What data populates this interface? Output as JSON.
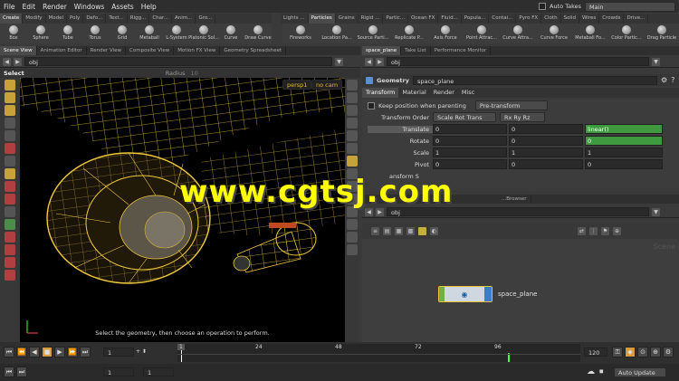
{
  "menubar": {
    "items": [
      "File",
      "Edit",
      "Render",
      "Windows",
      "Assets",
      "Help"
    ],
    "auto_takes": "Auto Takes",
    "desktop": "Main"
  },
  "shelf_left": {
    "tabs": [
      "Create",
      "Modify",
      "Model",
      "Poly",
      "Defo...",
      "Text...",
      "Rigg...",
      "Char...",
      "Anim...",
      "Gro..."
    ],
    "tools": [
      "Box",
      "Sphere",
      "Tube",
      "Torus",
      "Grid",
      "Metaball",
      "L-System",
      "Platonic Sol...",
      "Curve",
      "Draw Curve"
    ]
  },
  "shelf_right": {
    "tabs": [
      "Lights ...",
      "Particles",
      "Grains",
      "Rigid ...",
      "Partic...",
      "Ocean FX",
      "Fluid...",
      "Popula...",
      "Contai...",
      "Pyro FX",
      "Cloth",
      "Solid",
      "Wires",
      "Crowds",
      "Drive..."
    ],
    "tools": [
      "Fireworks",
      "Location Pa...",
      "Source Parti...",
      "Replicate P...",
      "Axis Force",
      "Point Attrac...",
      "Curve Attra...",
      "Curve Force",
      "Metaball Fo...",
      "Color Partic...",
      "Drag Particle"
    ]
  },
  "left_pane": {
    "tabs": [
      "Scene View",
      "Animation Editor",
      "Render View",
      "Composite View",
      "Motion FX View",
      "Geometry Spreadsheet"
    ],
    "path": "obj",
    "select_label": "Select",
    "radius_label": "Radius",
    "radius_value": "10",
    "persp": "persp1",
    "cam": "no cam",
    "prompt": "Select the geometry, then choose an operation to perform."
  },
  "params_pane": {
    "tabs": [
      "space_plane",
      "Take List",
      "Performance Monitor"
    ],
    "path": "obj",
    "node_type": "Geometry",
    "node_name": "space_plane",
    "sub_tabs": [
      "Transform",
      "Material",
      "Render",
      "Misc"
    ],
    "keep_position_label": "Keep position when parenting",
    "keep_position_value": "Pre-transform",
    "transform_order_label": "Transform Order",
    "transform_order_value": "Scale Rot Trans",
    "rot_order_value": "Rx Ry Rz",
    "rows": [
      {
        "label": "Translate",
        "values": [
          "0",
          "0",
          "linear()"
        ]
      },
      {
        "label": "Rotate",
        "values": [
          "0",
          "0",
          "0"
        ]
      },
      {
        "label": "Scale",
        "values": [
          "1",
          "1",
          "1"
        ]
      },
      {
        "label": "Pivot",
        "values": [
          "0",
          "0",
          "0"
        ]
      }
    ],
    "cut_label": "ansform S"
  },
  "network_pane": {
    "tab": "...Browser",
    "path": "obj",
    "node_label": "space_plane",
    "corner_label": "Scene"
  },
  "timeline": {
    "frame": "1",
    "start": "1",
    "end": "120",
    "ticks": [
      "1",
      "24",
      "48",
      "72",
      "96",
      "120"
    ]
  },
  "status": {
    "auto_update": "Auto Update"
  },
  "watermark": "www.cgtsj.com"
}
